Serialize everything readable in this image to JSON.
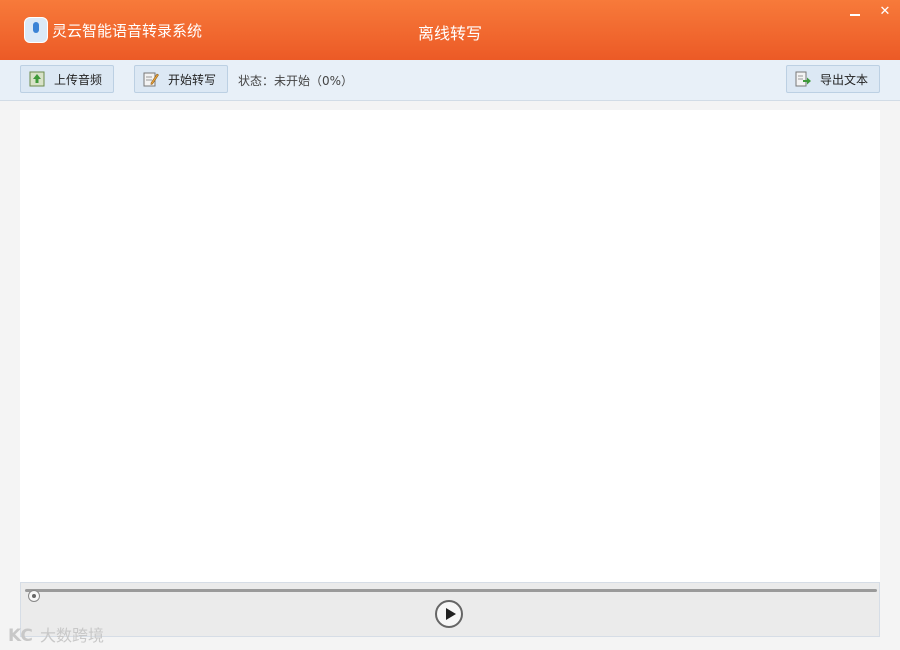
{
  "titlebar": {
    "app_title": "灵云智能语音转录系统",
    "page_title": "离线转写",
    "minimize_label": "–",
    "close_label": "✕",
    "accent_color": "#ee6a2e"
  },
  "toolbar": {
    "upload_label": "上传音频",
    "start_label": "开始转写",
    "status": "状态：未开始（0%）",
    "export_label": "导出文本"
  },
  "player": {
    "progress_percent": 0
  },
  "watermark": {
    "logo": "KC",
    "text": "大数跨境"
  }
}
